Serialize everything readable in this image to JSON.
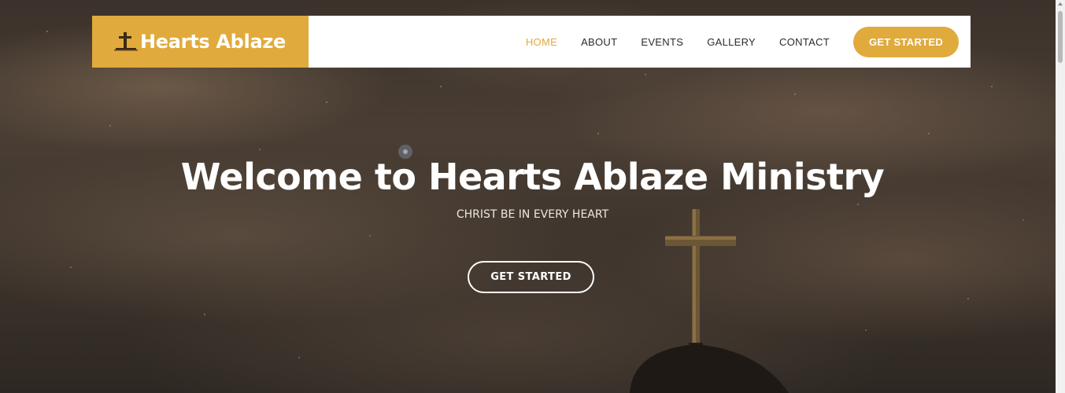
{
  "brand": {
    "name": "Hearts Ablaze",
    "accent": "#e1aa3c"
  },
  "nav": {
    "items": [
      {
        "label": "HOME",
        "active": true
      },
      {
        "label": "ABOUT",
        "active": false
      },
      {
        "label": "EVENTS",
        "active": false
      },
      {
        "label": "GALLERY",
        "active": false
      },
      {
        "label": "CONTACT",
        "active": false
      }
    ],
    "cta_label": "GET STARTED"
  },
  "hero": {
    "title": "Welcome to Hearts Ablaze Ministry",
    "subtitle": "CHRIST BE IN EVERY HEART",
    "button_label": "GET STARTED"
  },
  "icons": {
    "logo": "cross-icon"
  }
}
